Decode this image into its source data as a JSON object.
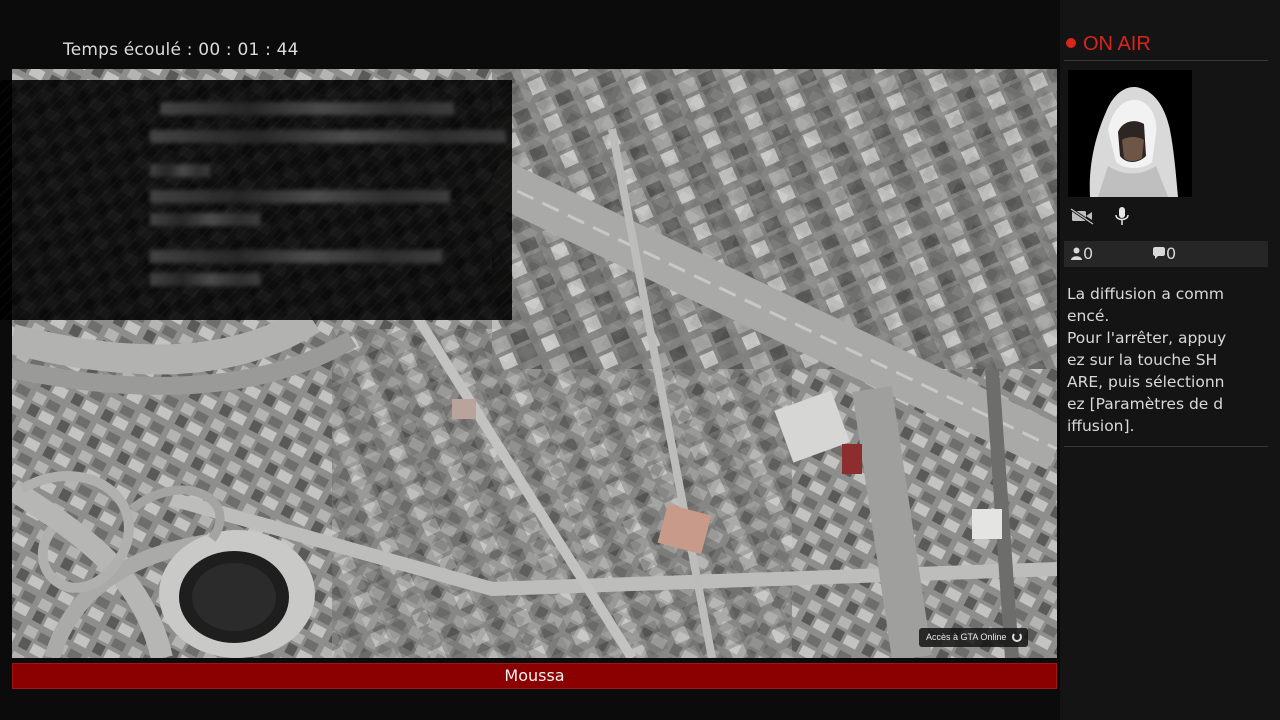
{
  "header": {
    "elapsed_label": "Temps écoulé",
    "elapsed_time": "00 : 01 : 44"
  },
  "game": {
    "online_access_label": "Accès à GTA Online"
  },
  "streamer": {
    "name": "Moussa"
  },
  "sidebar": {
    "status": "ON AIR",
    "viewers": "0",
    "comments": "0",
    "message": "La diffusion a commencé.\nPour l'arrêter, appuyez sur la touche SHARE, puis sélectionnez [Paramètres de diffusion]."
  },
  "colors": {
    "on_air_red": "#d8261c",
    "name_bar_red": "#8b0000"
  }
}
